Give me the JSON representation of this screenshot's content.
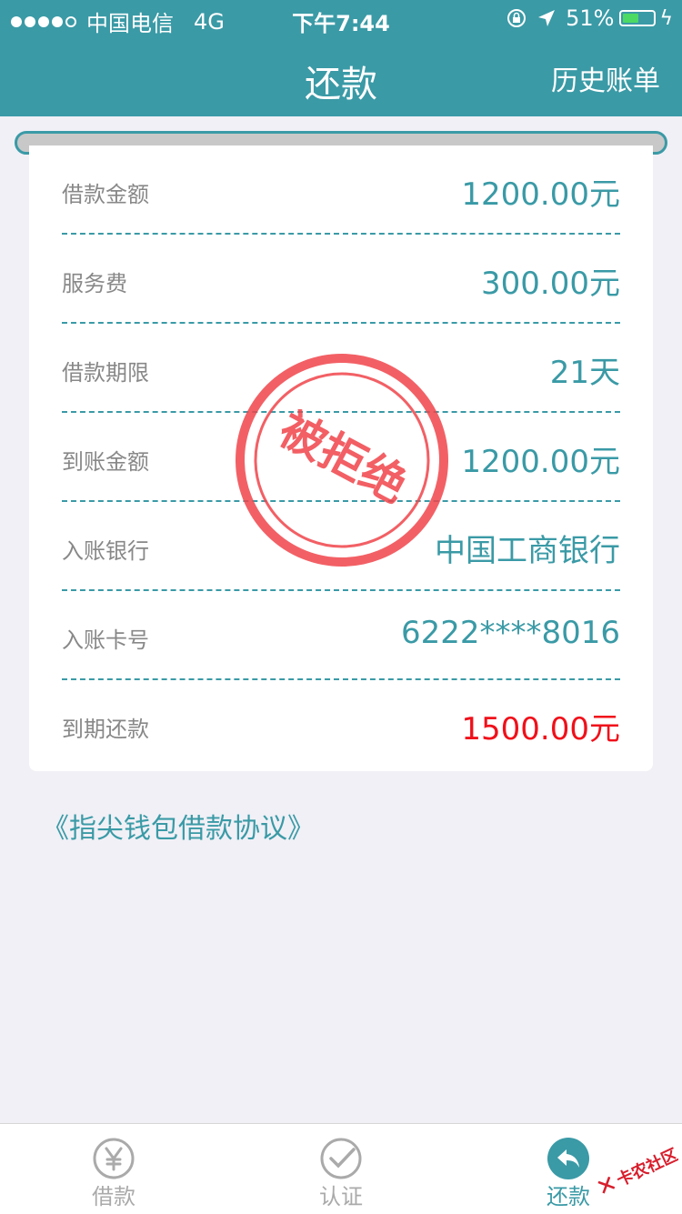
{
  "status_bar": {
    "carrier": "中国电信",
    "network": "4G",
    "time": "下午7:44",
    "battery": "51%",
    "battery_level": 0.51
  },
  "header": {
    "title": "还款",
    "right_link": "历史账单"
  },
  "loan_details": [
    {
      "label": "借款金额",
      "value": "1200.00元"
    },
    {
      "label": "服务费",
      "value": "300.00元"
    },
    {
      "label": "借款期限",
      "value": "21天"
    },
    {
      "label": "到账金额",
      "value": "1200.00元"
    },
    {
      "label": "入账银行",
      "value": "中国工商银行"
    },
    {
      "label": "入账卡号",
      "value": "6222****8016"
    },
    {
      "label": "到期还款",
      "value": "1500.00元"
    }
  ],
  "stamp": {
    "text": "被拒绝",
    "color": "#f0444a"
  },
  "agreement_link": "《指尖钱包借款协议》",
  "tabs": [
    {
      "label": "借款",
      "icon": "yen-icon"
    },
    {
      "label": "认证",
      "icon": "check-icon"
    },
    {
      "label": "还款",
      "icon": "reply-icon"
    }
  ],
  "watermark": {
    "text": "卡农社区"
  },
  "colors": {
    "accent": "#3a9aa6",
    "highlight": "#f0101a"
  }
}
